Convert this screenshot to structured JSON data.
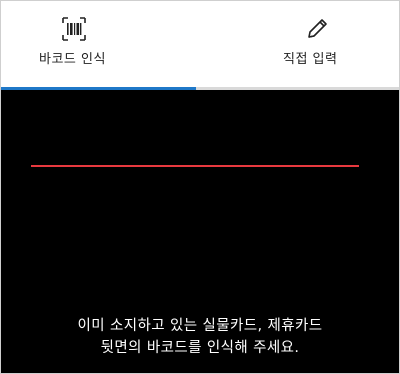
{
  "tabs": [
    {
      "label": "바코드 인식",
      "icon": "barcode-scan-icon",
      "selected": true
    },
    {
      "label": "직접 입력",
      "icon": "pencil-icon",
      "selected": false
    }
  ],
  "selected_tab_progress": 0.49,
  "scanner": {
    "scan_line_color": "#e8393f",
    "guide_line1": "이미 소지하고 있는 실물카드, 제휴카드",
    "guide_line2": "뒷면의 바코드를 인식해 주세요."
  },
  "colors": {
    "accent": "#1f78c8",
    "background": "#000000"
  }
}
